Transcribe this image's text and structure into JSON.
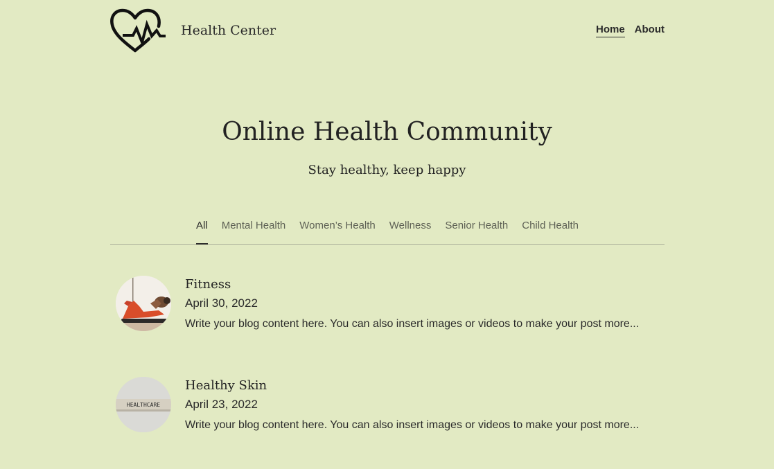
{
  "site": {
    "name": "Health Center",
    "logo_icon": "heart-pulse-icon"
  },
  "nav": {
    "items": [
      {
        "label": "Home",
        "active": true
      },
      {
        "label": "About",
        "active": false
      }
    ]
  },
  "hero": {
    "title": "Online Health Community",
    "subtitle": "Stay healthy, keep happy"
  },
  "tabs": [
    {
      "label": "All",
      "active": true
    },
    {
      "label": "Mental Health",
      "active": false
    },
    {
      "label": "Women’s Health",
      "active": false
    },
    {
      "label": "Wellness",
      "active": false
    },
    {
      "label": "Senior Health",
      "active": false
    },
    {
      "label": "Child Health",
      "active": false
    }
  ],
  "posts": [
    {
      "title": "Fitness",
      "date": "April 30, 2022",
      "excerpt": "Write your blog content here. You can also insert images or videos to make your post more...",
      "image": "fitness-photo"
    },
    {
      "title": "Healthy Skin",
      "date": "April 23, 2022",
      "excerpt": "Write your blog content here. You can also insert images or videos to make your post more...",
      "image": "healthcare-blocks-photo",
      "image_text": "HEALTHCARE"
    }
  ],
  "colors": {
    "background": "#e2eac3",
    "text": "#232323",
    "muted_text": "#5e6155",
    "divider": "#a9ae98"
  }
}
